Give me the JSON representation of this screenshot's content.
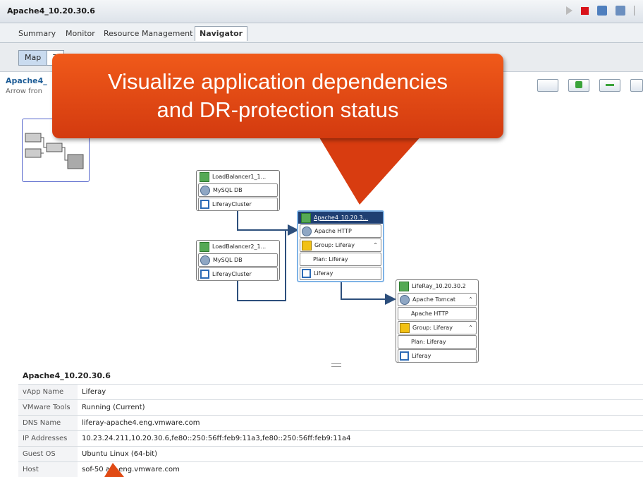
{
  "window": {
    "title": "Apache4_10.20.30.6"
  },
  "tabs": [
    {
      "label": "Summary"
    },
    {
      "label": "Monitor"
    },
    {
      "label": "Resource Management"
    },
    {
      "label": "Navigator"
    }
  ],
  "view_toggle": {
    "map": "Map",
    "other": "T"
  },
  "breadcrumb": {
    "title": "Apache4_",
    "subtitle": "Arrow fron"
  },
  "callout": {
    "line1": "Visualize application dependencies",
    "line2": "and DR-protection status"
  },
  "nodes": {
    "lb1": {
      "title": "LoadBalancer1_1...",
      "rows": [
        "MySQL DB",
        "LiferayCluster"
      ]
    },
    "lb2": {
      "title": "LoadBalancer2_1...",
      "rows": [
        "MySQL DB",
        "LiferayCluster"
      ]
    },
    "apache": {
      "title": "Apache4_10.20.3...",
      "rows": [
        "Apache HTTP",
        "Group: Liferay",
        "Plan: Liferay",
        "Liferay"
      ]
    },
    "liferay": {
      "title": "LifeRay_10.20.30.2",
      "rows": [
        "Apache Tomcat",
        "Apache HTTP",
        "Group: Liferay",
        "Plan: Liferay",
        "Liferay"
      ]
    }
  },
  "details": {
    "title": "Apache4_10.20.30.6",
    "rows": [
      {
        "key": "vApp Name",
        "value": "Liferay"
      },
      {
        "key": "VMware Tools",
        "value": "Running (Current)"
      },
      {
        "key": "DNS Name",
        "value": "liferay-apache4.eng.vmware.com"
      },
      {
        "key": "IP Addresses",
        "value": "10.23.24.211,10.20.30.6,fe80::250:56ff:feb9:11a3,fe80::250:56ff:feb9:11a4"
      },
      {
        "key": "Guest OS",
        "value": "Ubuntu Linux (64-bit)"
      },
      {
        "key": "Host",
        "value": "sof-50    al2.eng.vmware.com"
      }
    ]
  },
  "colors": {
    "callout": "#e04a14",
    "selection": "#1f3f72",
    "link": "#2d4f7c"
  }
}
